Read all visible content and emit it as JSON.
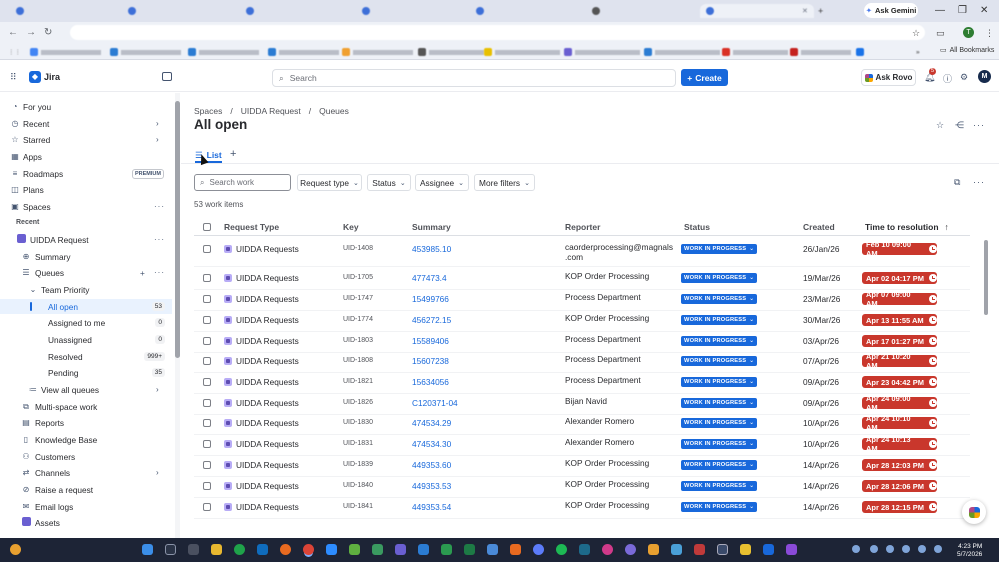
{
  "browser": {
    "ask_gemini": "Ask Gemini",
    "all_bookmarks": "All Bookmarks",
    "profile_initial": "T"
  },
  "topnav": {
    "product": "Jira",
    "search_placeholder": "Search",
    "create_label": "Create",
    "rovo_label": "Ask Rovo",
    "notifications_count": "5",
    "avatar_initial": "M"
  },
  "sidebar": {
    "items": [
      {
        "label": "For you"
      },
      {
        "label": "Recent"
      },
      {
        "label": "Starred"
      },
      {
        "label": "Apps"
      },
      {
        "label": "Roadmaps",
        "badge": "PREMIUM"
      },
      {
        "label": "Plans"
      },
      {
        "label": "Spaces"
      }
    ],
    "recent_heading": "Recent",
    "project": "UIDDA Request",
    "project_items": [
      {
        "label": "Summary"
      },
      {
        "label": "Queues"
      },
      {
        "label": "Team Priority"
      },
      {
        "label": "All open",
        "count": "53"
      },
      {
        "label": "Assigned to me",
        "count": "0"
      },
      {
        "label": "Unassigned",
        "count": "0"
      },
      {
        "label": "Resolved",
        "count": "999+"
      },
      {
        "label": "Pending",
        "count": "35"
      },
      {
        "label": "View all queues"
      }
    ],
    "tools": [
      {
        "label": "Multi-space work"
      },
      {
        "label": "Reports"
      },
      {
        "label": "Knowledge Base"
      },
      {
        "label": "Customers"
      },
      {
        "label": "Channels"
      },
      {
        "label": "Raise a request"
      },
      {
        "label": "Email logs"
      },
      {
        "label": "Assets"
      }
    ]
  },
  "main": {
    "breadcrumb": [
      "Spaces",
      "UIDDA Request",
      "Queues"
    ],
    "title": "All open",
    "view_tab": "List",
    "filter_search_placeholder": "Search work",
    "filters": [
      "Request type",
      "Status",
      "Assignee",
      "More filters"
    ],
    "count_label": "53 work items",
    "columns": [
      "Request Type",
      "Key",
      "Summary",
      "Reporter",
      "Status",
      "Created",
      "Time to resolution"
    ],
    "rows": [
      {
        "type": "UIDDA Requests",
        "key": "UID-1408",
        "summary": "453985.10",
        "reporter": "caorderprocessing@magnals",
        "reporter2": ".com",
        "status": "WORK IN PROGRESS",
        "created": "26/Jan/26",
        "ttr": "Feb 10 09:00 AM"
      },
      {
        "type": "UIDDA Requests",
        "key": "UID-1705",
        "summary": "477473.4",
        "reporter": "KOP Order Processing",
        "status": "WORK IN PROGRESS",
        "created": "19/Mar/26",
        "ttr": "Apr 02 04:17 PM"
      },
      {
        "type": "UIDDA Requests",
        "key": "UID-1747",
        "summary": "15499766",
        "reporter": "Process Department",
        "status": "WORK IN PROGRESS",
        "created": "23/Mar/26",
        "ttr": "Apr 07 09:00 AM"
      },
      {
        "type": "UIDDA Requests",
        "key": "UID-1774",
        "summary": "456272.15",
        "reporter": "KOP Order Processing",
        "status": "WORK IN PROGRESS",
        "created": "30/Mar/26",
        "ttr": "Apr 13 11:55 AM"
      },
      {
        "type": "UIDDA Requests",
        "key": "UID-1803",
        "summary": "15589406",
        "reporter": "Process Department",
        "status": "WORK IN PROGRESS",
        "created": "03/Apr/26",
        "ttr": "Apr 17 01:27 PM"
      },
      {
        "type": "UIDDA Requests",
        "key": "UID-1808",
        "summary": "15607238",
        "reporter": "Process Department",
        "status": "WORK IN PROGRESS",
        "created": "07/Apr/26",
        "ttr": "Apr 21 10:20 AM"
      },
      {
        "type": "UIDDA Requests",
        "key": "UID-1821",
        "summary": "15634056",
        "reporter": "Process Department",
        "status": "WORK IN PROGRESS",
        "created": "09/Apr/26",
        "ttr": "Apr 23 04:42 PM"
      },
      {
        "type": "UIDDA Requests",
        "key": "UID-1826",
        "summary": "C120371-04",
        "reporter": "Bijan Navid",
        "status": "WORK IN PROGRESS",
        "created": "09/Apr/26",
        "ttr": "Apr 24 09:00 AM"
      },
      {
        "type": "UIDDA Requests",
        "key": "UID-1830",
        "summary": "474534.29",
        "reporter": "Alexander Romero",
        "status": "WORK IN PROGRESS",
        "created": "10/Apr/26",
        "ttr": "Apr 24 10:10 AM"
      },
      {
        "type": "UIDDA Requests",
        "key": "UID-1831",
        "summary": "474534.30",
        "reporter": "Alexander Romero",
        "status": "WORK IN PROGRESS",
        "created": "10/Apr/26",
        "ttr": "Apr 24 10:13 AM"
      },
      {
        "type": "UIDDA Requests",
        "key": "UID-1839",
        "summary": "449353.60",
        "reporter": "KOP Order Processing",
        "status": "WORK IN PROGRESS",
        "created": "14/Apr/26",
        "ttr": "Apr 28 12:03 PM"
      },
      {
        "type": "UIDDA Requests",
        "key": "UID-1840",
        "summary": "449353.53",
        "reporter": "KOP Order Processing",
        "status": "WORK IN PROGRESS",
        "created": "14/Apr/26",
        "ttr": "Apr 28 12:06 PM"
      },
      {
        "type": "UIDDA Requests",
        "key": "UID-1841",
        "summary": "449353.54",
        "reporter": "KOP Order Processing",
        "status": "WORK IN PROGRESS",
        "created": "14/Apr/26",
        "ttr": "Apr 28 12:15 PM"
      }
    ]
  },
  "taskbar": {
    "time": "4:23 PM",
    "date": "5/7/2026"
  },
  "colors": {
    "accent": "#1868db",
    "breach": "#c9372c"
  }
}
